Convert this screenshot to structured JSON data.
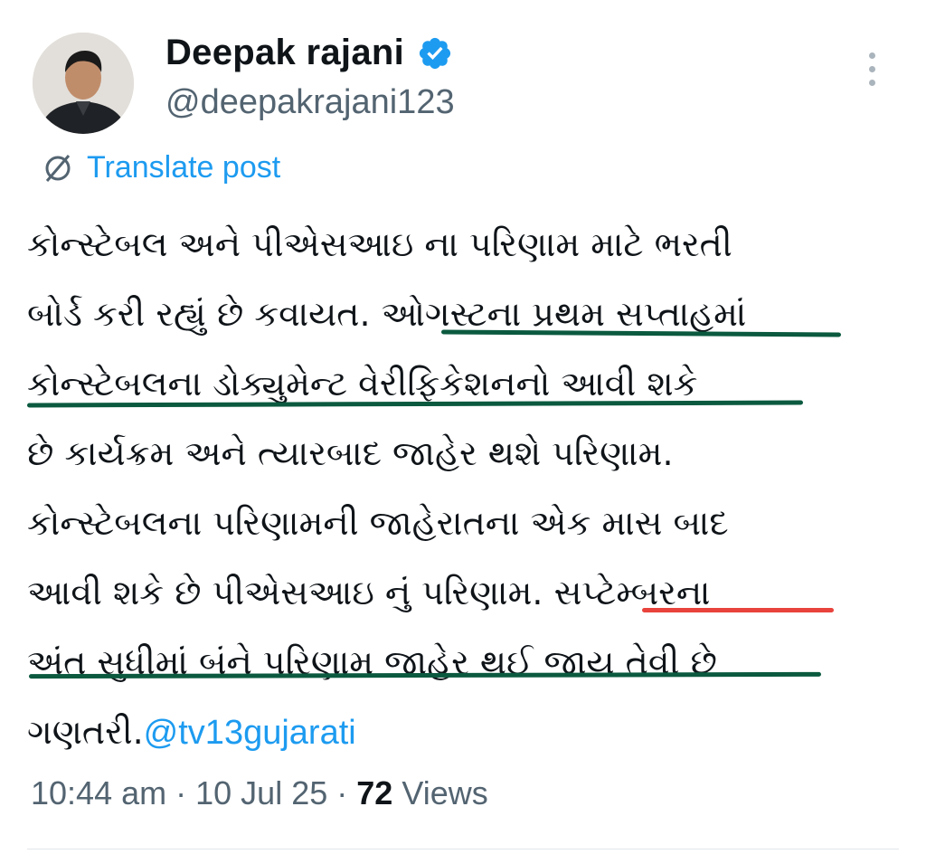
{
  "author": {
    "name": "Deepak rajani",
    "handle": "@deepakrajani123",
    "avatar_icon": "profile-photo",
    "verified_icon": "verified-badge-icon"
  },
  "translate": {
    "label": "Translate post",
    "icon": "translate-globe-icon"
  },
  "post": {
    "lines": [
      "કોન્સ્ટેબલ અને પીએસઆઇ ના પરિણામ માટે ભરતી",
      "બોર્ડ કરી રહ્યું છે કવાયત. ઓગસ્ટના પ્રથમ સપ્તાહમાં",
      "કોન્સ્ટેબલના ડોક્યુમેન્ટ વેરીફિકેશનનો આવી શકે",
      "છે કાર્યક્રમ અને ત્યારબાદ જાહેર થશે પરિણામ.",
      "કોન્સ્ટેબલના પરિણામની જાહેરાતના એક માસ બાદ",
      "આવી શકે છે પીએસઆઇ નું પરિણામ. સપ્ટેમ્બરના",
      "અંત સુધીમાં બંને પરિણામ જાહેર થઈ જાય તેવી છે",
      "ગણતરી."
    ],
    "mention": "@tv13gujarati"
  },
  "meta": {
    "time": "10:44 am",
    "separator": "·",
    "date": "10 Jul 25",
    "views_count": "72",
    "views_label": "Views"
  },
  "colors": {
    "link": "#1d9bf0",
    "underline_green": "#0b5a3f",
    "underline_red": "#e8433c",
    "secondary_text": "#536471"
  }
}
